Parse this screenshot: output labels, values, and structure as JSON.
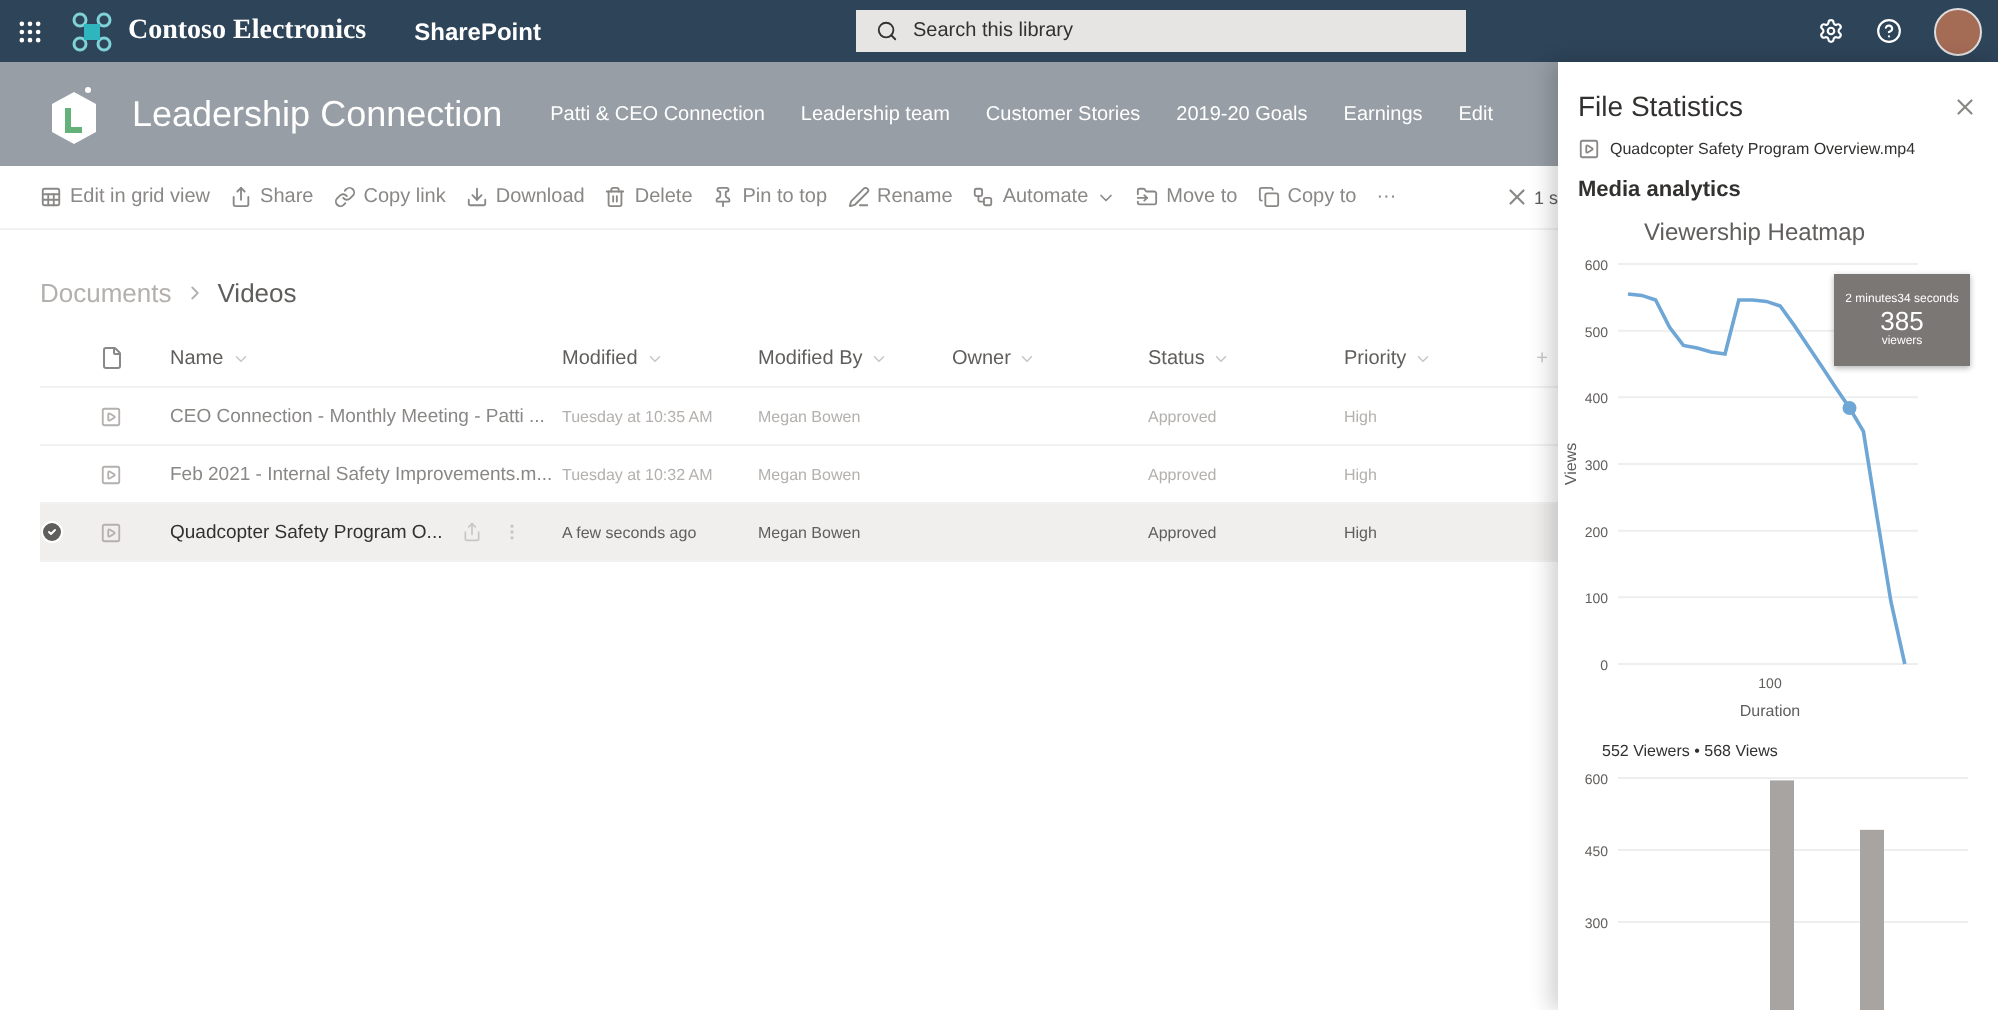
{
  "top_bar": {
    "brand": "Contoso Electronics",
    "app": "SharePoint",
    "search": {
      "placeholder": "Search this library"
    }
  },
  "site_header": {
    "title": "Leadership Connection",
    "nav": [
      {
        "label": "Patti & CEO Connection"
      },
      {
        "label": "Leadership team"
      },
      {
        "label": "Customer Stories"
      },
      {
        "label": "2019-20 Goals"
      },
      {
        "label": "Earnings"
      },
      {
        "label": "Edit"
      }
    ]
  },
  "command_bar": {
    "commands": [
      {
        "kind": "grid",
        "label": "Edit in grid view"
      },
      {
        "kind": "share",
        "label": "Share"
      },
      {
        "kind": "link",
        "label": "Copy link"
      },
      {
        "kind": "download",
        "label": "Download"
      },
      {
        "kind": "delete",
        "label": "Delete"
      },
      {
        "kind": "pin",
        "label": "Pin to top"
      },
      {
        "kind": "rename",
        "label": "Rename"
      },
      {
        "kind": "automate",
        "label": "Automate"
      },
      {
        "kind": "move",
        "label": "Move to"
      },
      {
        "kind": "copy",
        "label": "Copy to"
      },
      {
        "kind": "more",
        "label": "···"
      }
    ],
    "selection_count": "1 s"
  },
  "breadcrumb": [
    {
      "label": "Documents"
    },
    {
      "label": "Videos"
    }
  ],
  "table": {
    "columns": [
      "Name",
      "Modified",
      "Modified By",
      "Owner",
      "Status",
      "Priority"
    ],
    "add_column": "+",
    "rows": [
      {
        "selected": false,
        "name": "CEO Connection - Monthly Meeting - Patti ...",
        "modified": "Tuesday at 10:35 AM",
        "modified_by": "Megan Bowen",
        "status": "Approved",
        "priority": "High"
      },
      {
        "selected": false,
        "name": "Feb 2021 - Internal Safety Improvements.m...",
        "modified": "Tuesday at 10:32 AM",
        "modified_by": "Megan Bowen",
        "status": "Approved",
        "priority": "High"
      },
      {
        "selected": true,
        "name": "Quadcopter Safety Program O...",
        "modified": "A few seconds ago",
        "modified_by": "Megan Bowen",
        "status": "Approved",
        "priority": "High"
      }
    ]
  },
  "panel": {
    "title": "File Statistics",
    "file": "Quadcopter Safety Program Overview.mp4",
    "section": "Media analytics",
    "heatmap": {
      "chart_data": {
        "type": "line",
        "title": "Viewership Heatmap",
        "xlabel": "Duration",
        "ylabel": "Views",
        "values": [
          555,
          553,
          546,
          505,
          478,
          474,
          468,
          465,
          546,
          546,
          544,
          537,
          508,
          477,
          446,
          415,
          384,
          349,
          219,
          93,
          0
        ],
        "ylim": [
          0,
          600
        ],
        "yticks": [
          0,
          100,
          200,
          300,
          400,
          500,
          600
        ],
        "grid": true
      },
      "x_tick": "100",
      "tooltip": {
        "title": "2 minutes34 seconds",
        "value": "385",
        "unit": "viewers"
      }
    },
    "summary": "552 Viewers • 568 Views",
    "viewers": {
      "chart_data": {
        "type": "bar",
        "values": [
          null,
          595,
          492
        ],
        "ylim": [
          0,
          600
        ],
        "yticks": [
          300,
          450,
          600
        ],
        "grid": true
      }
    }
  }
}
